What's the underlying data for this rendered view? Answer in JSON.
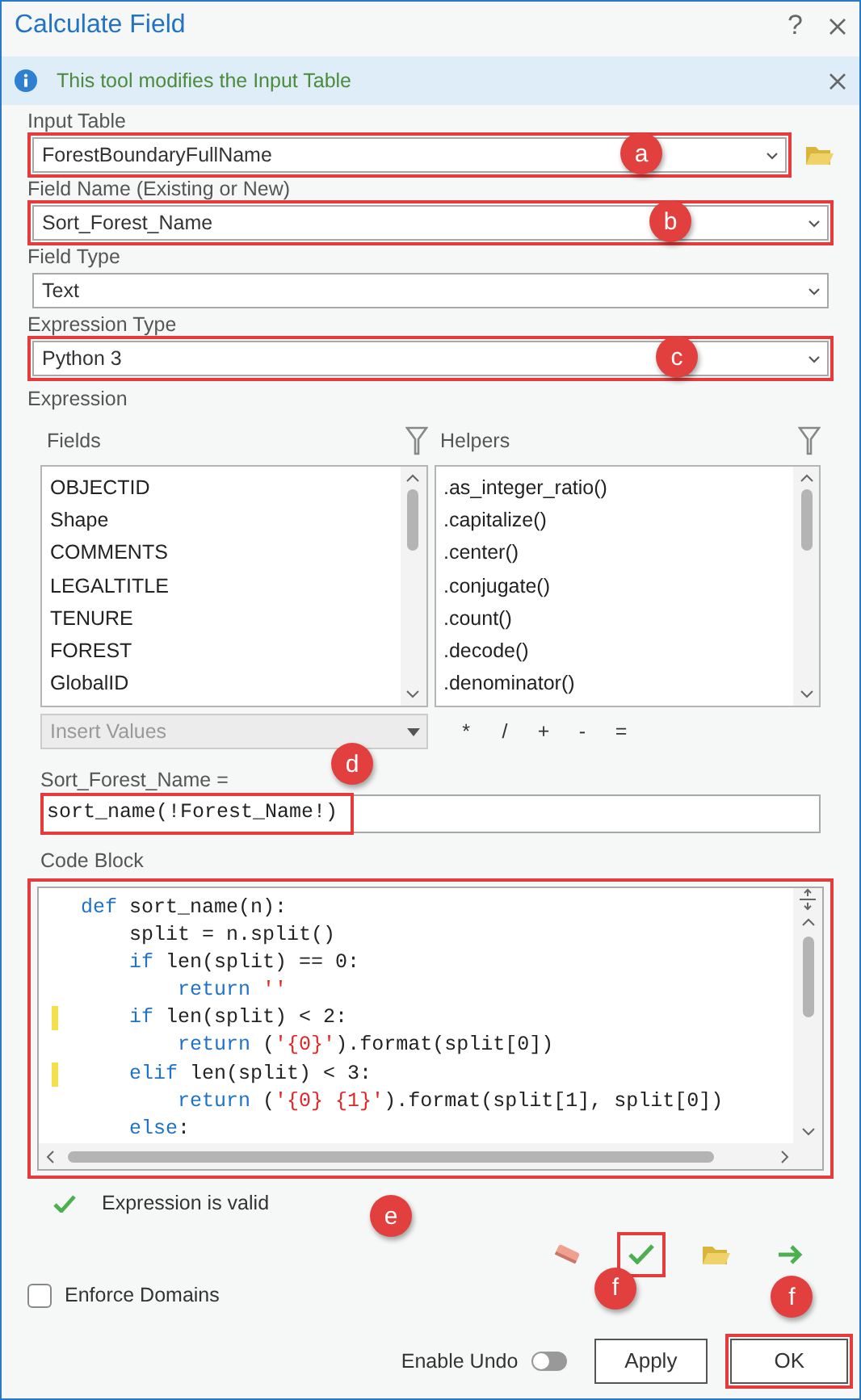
{
  "window": {
    "title": "Calculate Field",
    "help": "?"
  },
  "info_bar": {
    "message": "This tool modifies the Input Table"
  },
  "params": [
    {
      "label": "Input Table",
      "value": "ForestBoundaryFullName",
      "highlighted": true,
      "callout": "a",
      "browse": true
    },
    {
      "label": "Field Name (Existing or New)",
      "value": "Sort_Forest_Name",
      "highlighted": true,
      "callout": "b",
      "browse": false
    },
    {
      "label": "Field Type",
      "value": "Text",
      "highlighted": false,
      "browse": false
    },
    {
      "label": "Expression Type",
      "value": "Python 3",
      "highlighted": true,
      "callout": "c",
      "browse": false
    }
  ],
  "expression": {
    "label": "Expression",
    "fields": {
      "title": "Fields",
      "items": [
        "OBJECTID",
        "Shape",
        "COMMENTS",
        "LEGALTITLE",
        "TENURE",
        "FOREST",
        "GlobalID"
      ]
    },
    "helpers": {
      "title": "Helpers",
      "items": [
        ".as_integer_ratio()",
        ".capitalize()",
        ".center()",
        ".conjugate()",
        ".count()",
        ".decode()",
        ".denominator()"
      ]
    },
    "insert_values": {
      "placeholder": "Insert Values",
      "disabled": true
    },
    "operators": [
      "*",
      "/",
      "+",
      "-",
      "="
    ],
    "target_label": "Sort_Forest_Name =",
    "value": "sort_name(!Forest_Name!)",
    "highlighted": true,
    "callout": "d"
  },
  "code_block": {
    "label": "Code Block",
    "highlighted": true,
    "callout": "e",
    "lines": [
      {
        "changed": false,
        "tokens": [
          {
            "kind": "keyword",
            "text": "def"
          },
          {
            "kind": "plain",
            "text": " sort_name(n):"
          }
        ]
      },
      {
        "changed": false,
        "tokens": [
          {
            "kind": "plain",
            "text": "    split = n.split()"
          }
        ]
      },
      {
        "changed": false,
        "tokens": [
          {
            "kind": "keyword",
            "text": "    if"
          },
          {
            "kind": "plain",
            "text": " len(split) == 0:"
          }
        ]
      },
      {
        "changed": false,
        "tokens": [
          {
            "kind": "keyword",
            "text": "        return"
          },
          {
            "kind": "string",
            "text": " ''"
          }
        ]
      },
      {
        "changed": true,
        "tokens": [
          {
            "kind": "keyword",
            "text": "    if"
          },
          {
            "kind": "plain",
            "text": " len(split) < 2:"
          }
        ]
      },
      {
        "changed": false,
        "tokens": [
          {
            "kind": "keyword",
            "text": "        return"
          },
          {
            "kind": "plain",
            "text": " ("
          },
          {
            "kind": "string",
            "text": "'{0}'"
          },
          {
            "kind": "plain",
            "text": ").format(split[0])"
          }
        ]
      },
      {
        "changed": true,
        "tokens": [
          {
            "kind": "keyword",
            "text": "    elif"
          },
          {
            "kind": "plain",
            "text": " len(split) < 3:"
          }
        ]
      },
      {
        "changed": false,
        "tokens": [
          {
            "kind": "keyword",
            "text": "        return"
          },
          {
            "kind": "plain",
            "text": " ("
          },
          {
            "kind": "string",
            "text": "'{0} {1}'"
          },
          {
            "kind": "plain",
            "text": ").format(split[1], split[0])"
          }
        ]
      },
      {
        "changed": false,
        "tokens": [
          {
            "kind": "keyword",
            "text": "    else"
          },
          {
            "kind": "plain",
            "text": ":"
          }
        ]
      }
    ]
  },
  "validation": {
    "message": "Expression is valid"
  },
  "tools": [
    {
      "kind": "eraser",
      "highlighted": false
    },
    {
      "kind": "check",
      "highlighted": true,
      "callout": "f"
    },
    {
      "kind": "folder",
      "highlighted": false
    },
    {
      "kind": "arrow",
      "highlighted": false
    }
  ],
  "enforce_domains": {
    "label": "Enforce Domains",
    "checked": false
  },
  "enable_undo": {
    "label": "Enable Undo",
    "on": false
  },
  "buttons": [
    {
      "label": "Apply",
      "highlighted": false
    },
    {
      "label": "OK",
      "highlighted": true,
      "callout": "f"
    }
  ]
}
